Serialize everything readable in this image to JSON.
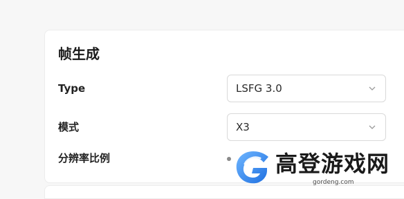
{
  "frame_generation": {
    "title": "帧生成",
    "type_label": "Type",
    "type_value": "LSFG 3.0",
    "mode_label": "模式",
    "mode_value": "X3",
    "resolution_scale_label": "分辨率比例"
  },
  "watermark": {
    "text": "高登游戏网",
    "url": "gordeng.com",
    "colors": {
      "logo_blue": "#1e6fe0",
      "logo_light": "#6fb6ff"
    }
  },
  "colors": {
    "page_bg": "#f7f7f7",
    "panel_bg": "#ffffff",
    "border": "#d9d9d9"
  }
}
